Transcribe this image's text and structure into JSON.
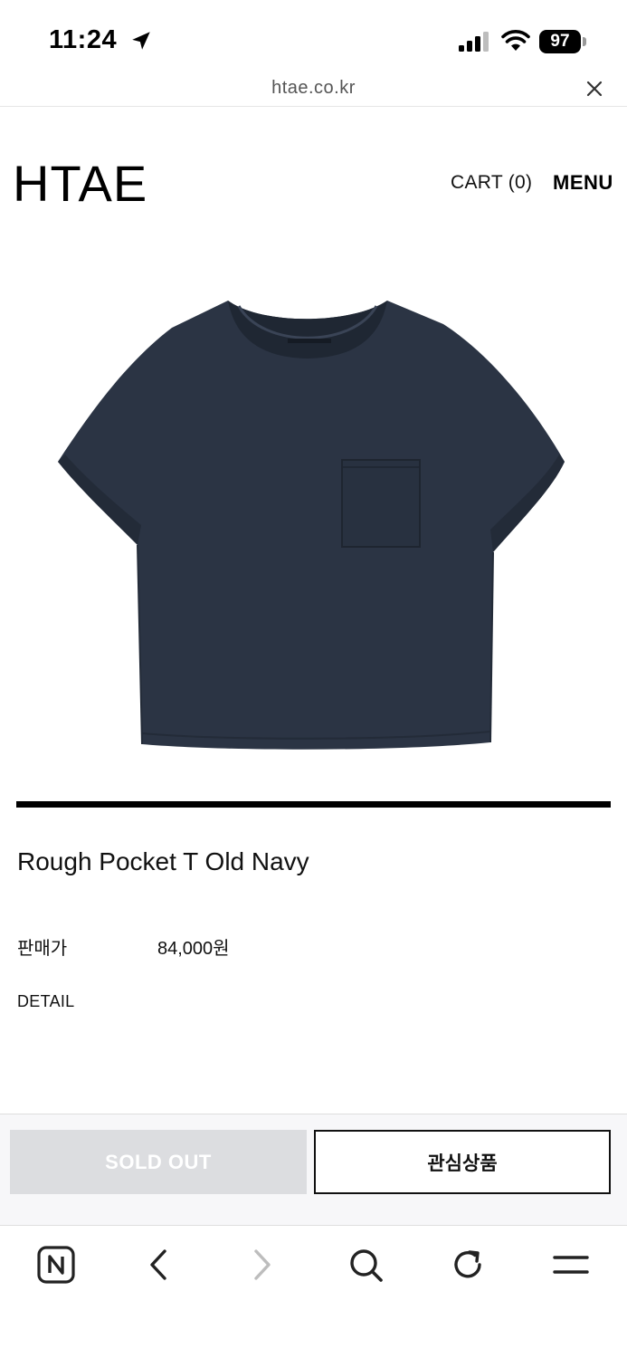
{
  "status_bar": {
    "time": "11:24",
    "battery": "97",
    "icons": [
      "location-arrow-icon",
      "signal-icon",
      "wifi-icon",
      "battery-icon"
    ]
  },
  "browser": {
    "url": "htae.co.kr",
    "close_icon": "close-icon"
  },
  "header": {
    "logo": "HTAE",
    "cart_label": "CART (0)",
    "menu_label": "MENU"
  },
  "product": {
    "name": "Rough Pocket T Old Navy",
    "price_label": "판매가",
    "price_value": "84,000원",
    "detail_label": "DETAIL",
    "image_color": "#2b3444"
  },
  "actions": {
    "sold_out_label": "SOLD OUT",
    "wishlist_label": "관심상품"
  },
  "toolbar": {
    "icons": [
      "naver-home-icon",
      "back-icon",
      "forward-icon",
      "search-icon",
      "refresh-icon",
      "menu-icon"
    ]
  },
  "colors": {
    "accent": "#000000",
    "disabled_button": "#dcdde0",
    "action_bar_bg": "#f7f7f9"
  }
}
